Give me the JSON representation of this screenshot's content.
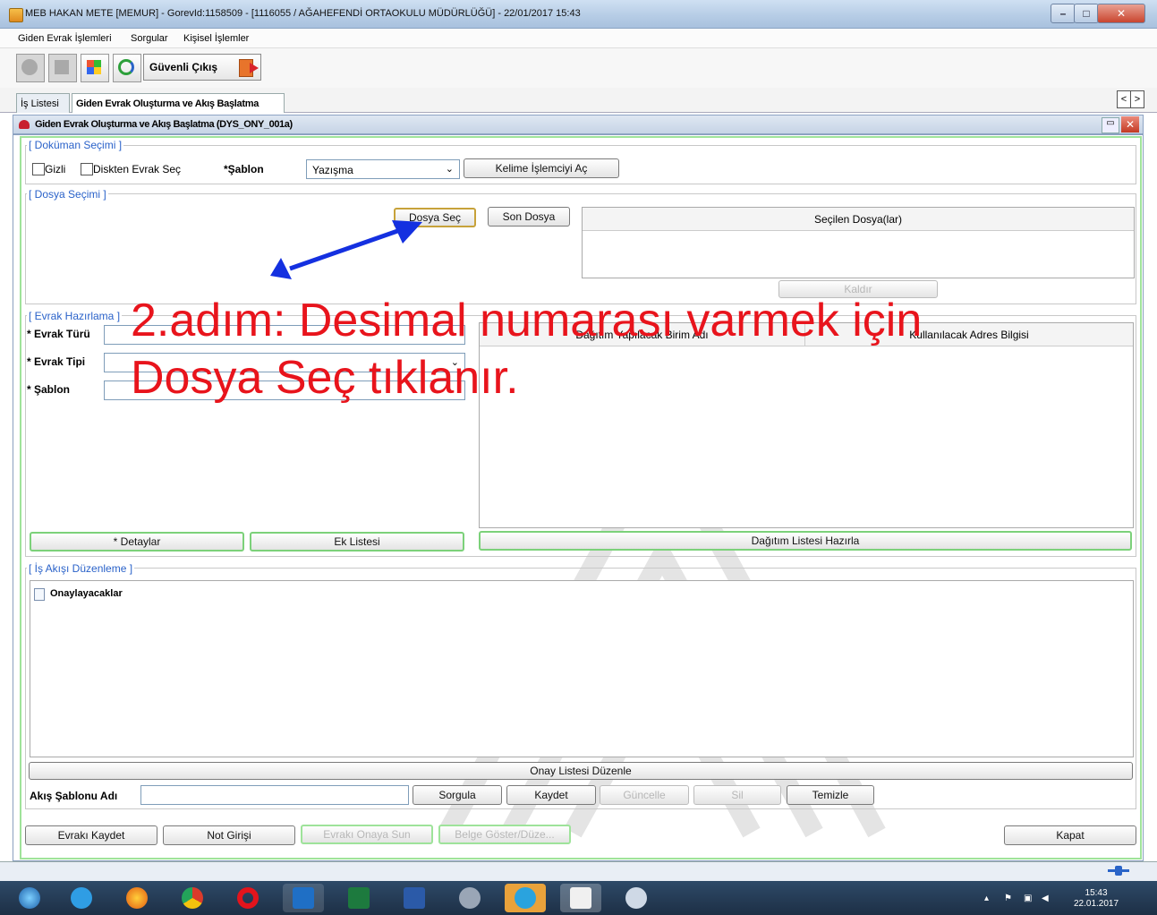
{
  "window": {
    "title": "MEB   HAKAN METE  [MEMUR] - GorevId:1158509 - [1116055 / AĞAHEFENDİ ORTAOKULU MÜDÜRLÜĞÜ] - 22/01/2017 15:43",
    "min_icon": "–",
    "max_icon": "□",
    "close_icon": "✕"
  },
  "menu": [
    "Giden Evrak İşlemleri",
    "Sorgular",
    "Kişisel İşlemler"
  ],
  "toolbar": {
    "secure_exit": "Güvenli Çıkış"
  },
  "tabs": [
    "İş Listesi",
    "Giden Evrak Oluşturma ve Akış Başlatma"
  ],
  "tab_nav": {
    "left": "<",
    "right": ">"
  },
  "frame": {
    "title": "Giden Evrak Oluşturma ve Akış Başlatma (DYS_ONY_001a)",
    "restore_icon": "▭",
    "close_icon": "✕"
  },
  "doc_section": {
    "label": "[ Doküman Seçimi ]",
    "gizli": "Gizli",
    "disk": "Diskten Evrak Seç",
    "sablon_label": "*Şablon",
    "sablon_value": "Yazışma",
    "word_button": "Kelime İşlemciyi Aç"
  },
  "file_section": {
    "label": "[ Dosya Seçimi ]",
    "select_button": "Dosya Seç",
    "last_button": "Son Dosya",
    "selected_header": "Seçilen Dosya(lar)",
    "remove_button": "Kaldır"
  },
  "prep_section": {
    "label": "[ Evrak Hazırlama ]",
    "tur_label": "* Evrak Türü",
    "tip_label": "* Evrak Tipi",
    "sablon_label": "* Şablon",
    "col1": "Dağıtım Yapılacak Birim Adı",
    "col2": "Kullanılacak Adres Bilgisi",
    "details_button": "* Detaylar",
    "attachments_button": "Ek Listesi",
    "distribution_button": "Dağıtım Listesi Hazırla"
  },
  "flow_section": {
    "label": "[ İş Akışı Düzenleme ]",
    "tree_item": "Onaylayacaklar",
    "approval_button": "Onay Listesi Düzenle",
    "flow_label": "Akış Şablonu Adı",
    "query_button": "Sorgula",
    "save_button": "Kaydet",
    "update_button": "Güncelle",
    "delete_button": "Sil",
    "clear_button": "Temizle"
  },
  "footer": {
    "save_doc": "Evrakı Kaydet",
    "note": "Not Girişi",
    "send": "Evrakı Onaya Sun",
    "show": "Belge Göster/Düze...",
    "close": "Kapat"
  },
  "annotation": {
    "line1": "2.adım: Desimal numarası varmek için",
    "line2": "Dosya Seç tıklanır."
  },
  "taskbar": {
    "time": "15:43",
    "date": "22.01.2017"
  }
}
